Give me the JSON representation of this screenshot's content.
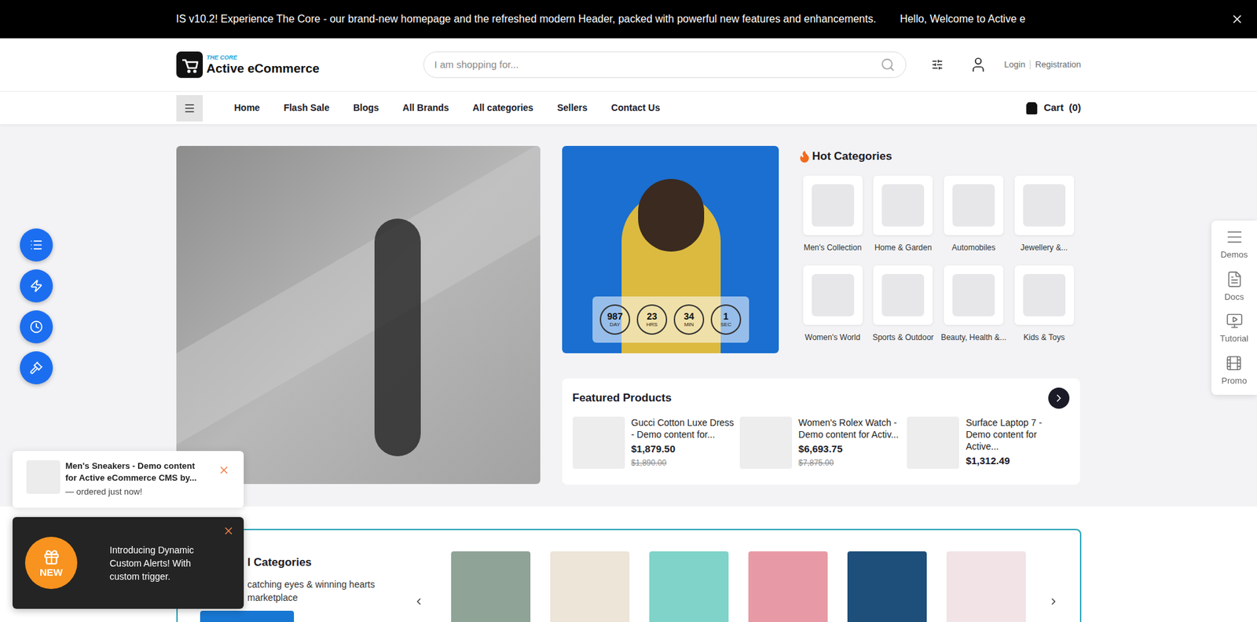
{
  "announcement": {
    "text": "IS v10.2! Experience The Core - our brand-new homepage and the refreshed modern Header, packed with powerful new features and enhancements.",
    "greeting": "Hello, Welcome to Active e"
  },
  "header": {
    "logo_tag": "THE CORE",
    "logo_name": "Active eCommerce",
    "search_placeholder": "I am shopping for...",
    "login": "Login",
    "registration": "Registration"
  },
  "nav": {
    "items": [
      "Home",
      "Flash Sale",
      "Blogs",
      "All Brands",
      "All categories",
      "Sellers",
      "Contact Us"
    ],
    "cart_label": "Cart",
    "cart_count": "(0)"
  },
  "flash_sale": {
    "countdown": [
      {
        "value": "987",
        "unit": "DAY"
      },
      {
        "value": "23",
        "unit": "HRS"
      },
      {
        "value": "34",
        "unit": "MIN"
      },
      {
        "value": "1",
        "unit": "SEC"
      }
    ]
  },
  "hot_categories": {
    "title": "Hot Categories",
    "items": [
      "Men's Collection",
      "Home & Garden",
      "Automobiles",
      "Jewellery &...",
      "Women's World",
      "Sports & Outdoor",
      "Beauty, Health &...",
      "Kids & Toys"
    ]
  },
  "featured_products": {
    "title": "Featured Products",
    "items": [
      {
        "name": "Gucci Cotton Luxe Dress - Demo content for...",
        "price": "$1,879.50",
        "old_price": "$1,890.00"
      },
      {
        "name": "Women's Rolex Watch - Demo content for Activ...",
        "price": "$6,693.75",
        "old_price": "$7,875.00"
      },
      {
        "name": "Surface Laptop 7 - Demo content for Active...",
        "price": "$1,312.49",
        "old_price": ""
      }
    ]
  },
  "featured_categories": {
    "title": "l Categories",
    "subtitle_lines": [
      "catching eyes & winning hearts",
      "marketplace"
    ]
  },
  "side_panel": {
    "items": [
      "Demos",
      "Docs",
      "Tutorial",
      "Promo"
    ]
  },
  "order_popup": {
    "product": "Men's Sneakers - Demo content for Active eCommerce CMS by...",
    "status": "— ordered just now!"
  },
  "alert_popup": {
    "badge": "NEW",
    "text": "Introducing Dynamic Custom Alerts! With custom trigger."
  }
}
